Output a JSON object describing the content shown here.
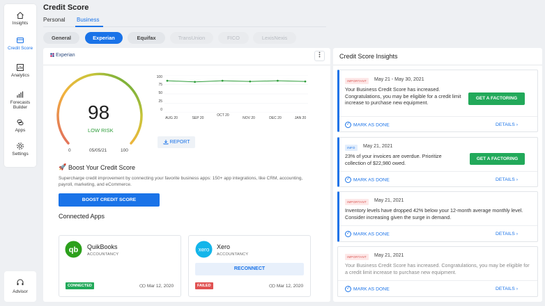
{
  "sidebar": {
    "items": [
      {
        "label": "Insights",
        "icon": "home-icon"
      },
      {
        "label": "Credit Score",
        "icon": "card-icon",
        "active": true
      },
      {
        "label": "Analytics",
        "icon": "analytics-icon"
      },
      {
        "label": "Forecasts Builder",
        "icon": "forecast-icon"
      },
      {
        "label": "Apps",
        "icon": "apps-icon"
      },
      {
        "label": "Settings",
        "icon": "gear-icon"
      }
    ],
    "advisor": "Advisor"
  },
  "page": {
    "title": "Credit Score"
  },
  "tabs": [
    {
      "label": "Personal"
    },
    {
      "label": "Business",
      "active": true
    }
  ],
  "bureaus": [
    "General",
    "Experian",
    "Equifax",
    "TransUnion",
    "FICO",
    "LexisNexis"
  ],
  "score_panel": {
    "logo": "Experian",
    "score": "98",
    "risk": "LOW RISK",
    "gauge_min": "0",
    "gauge_max": "100",
    "date": "05/05/21",
    "report_label": "REPORT"
  },
  "chart_data": {
    "type": "line",
    "x": [
      "AUG 20",
      "SEP 20",
      "OCT 20",
      "NOV 20",
      "DEC 20",
      "JAN 20"
    ],
    "series": [
      {
        "values": [
          85,
          82,
          85,
          83,
          85,
          83
        ]
      }
    ],
    "yticks": [
      "100",
      "75",
      "50",
      "25",
      "0"
    ],
    "ylim": [
      0,
      100
    ],
    "color": "#2e9d3a"
  },
  "boost": {
    "title": "Boost Your Credit Score",
    "text": "Supercharge credit improvement by connecting your favorite business apps: 150+ app integrations, like CRM, accounting, payroll, marketing, and eCommerce.",
    "button": "BOOST CREDIT SCORE"
  },
  "connected": {
    "title": "Connected Apps",
    "apps": [
      {
        "name": "QuikBooks",
        "category": "ACCOUNTANCY",
        "status": "CONNECTED",
        "date": "Mar 12, 2020"
      },
      {
        "name": "Xero",
        "category": "ACCOUNTANCY",
        "status": "FAILED",
        "date": "Mar 12, 2020",
        "action": "RECONNECT"
      }
    ]
  },
  "insights": {
    "title": "Credit Score Insights",
    "mark_label": "MARK AS DONE",
    "details_label": "DETAILS",
    "cards": [
      {
        "tag": "IMPORTANT",
        "date": "May 21 - May 30, 2021",
        "text": "Your Business Credit Score has increased. Congratulations, you may be eligible for a credit limit increase to purchase new equipment.",
        "button": "GET A FACTORING"
      },
      {
        "tag": "INFO",
        "date": "May 21, 2021",
        "text": "23% of your invoices are overdue. Prioritize collection of $22,980 owed.",
        "button": "GET A FACTORING"
      },
      {
        "tag": "IMPORTANT",
        "date": "May 21, 2021",
        "text": "Inventory levels have dropped 42% below your 12-month average monthly level. Consider increasing given the surge in demand."
      },
      {
        "tag": "IMPORTANT",
        "date": "May 21, 2021",
        "text": "Your Business Credit Score has increased. Congratulations, you may be eligible for a credit limit increase to purchase new equipment."
      }
    ]
  }
}
